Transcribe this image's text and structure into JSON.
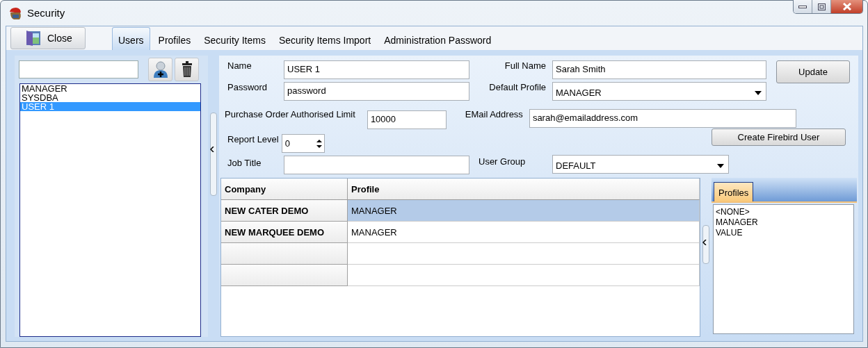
{
  "window": {
    "title": "Security"
  },
  "close_button": "Close",
  "tabs": [
    {
      "label": "Users",
      "selected": true
    },
    {
      "label": "Profiles",
      "selected": false
    },
    {
      "label": "Security Items",
      "selected": false
    },
    {
      "label": "Security Items Import",
      "selected": false
    },
    {
      "label": "Administration Password",
      "selected": false
    }
  ],
  "users": [
    {
      "label": "MANAGER",
      "selected": false
    },
    {
      "label": "SYSDBA",
      "selected": false
    },
    {
      "label": "USER 1",
      "selected": true
    }
  ],
  "form": {
    "name": {
      "label": "Name",
      "value": "USER 1"
    },
    "password": {
      "label": "Password",
      "value": "password"
    },
    "po_limit": {
      "label": "Purchase Order Authorised Limit",
      "value": "10000"
    },
    "report_level": {
      "label": "Report Level",
      "value": "0"
    },
    "job_title": {
      "label": "Job Title"
    },
    "full_name": {
      "label": "Full Name",
      "value": "Sarah Smith"
    },
    "default_profile": {
      "label": "Default Profile",
      "value": "MANAGER"
    },
    "email": {
      "label": "EMail Address",
      "value": "sarah@emailaddress.com"
    },
    "user_group": {
      "label": "User Group",
      "value": "DEFAULT"
    }
  },
  "buttons": {
    "update": "Update",
    "create_firebird_user": "Create Firebird User"
  },
  "grid": {
    "columns": [
      "Company",
      "Profile"
    ],
    "rows": [
      {
        "company": "NEW CATER DEMO",
        "profile": "MANAGER",
        "selected": true
      },
      {
        "company": "NEW MARQUEE DEMO",
        "profile": "MANAGER",
        "selected": false
      }
    ]
  },
  "profiles_panel": {
    "tab": "Profiles",
    "items": [
      "<NONE>",
      "MANAGER",
      "VALUE"
    ]
  }
}
